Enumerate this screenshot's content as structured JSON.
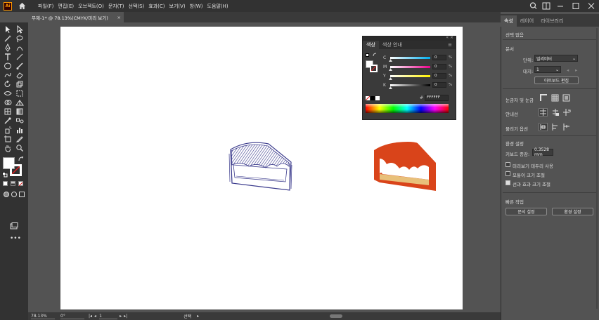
{
  "app": {
    "logo": "Ai",
    "menus": [
      "파일(F)",
      "편집(E)",
      "오브젝트(O)",
      "문자(T)",
      "선택(S)",
      "효과(C)",
      "보기(V)",
      "창(W)",
      "도움말(H)"
    ]
  },
  "document_tab": {
    "title": "무제-1* @ 78.13%(CMYK/미리 보기)",
    "close": "×"
  },
  "status_bar": {
    "zoom": "78.13%",
    "rotation": "0°",
    "artboard_number": "1",
    "selection_tool": "선택"
  },
  "right_panel": {
    "tabs": [
      "속성",
      "레이어",
      "라이브러리"
    ],
    "active_tab": "속성",
    "no_selection": "선택 없음",
    "document_section": "문서",
    "units_label": "단위:",
    "units_value": "밀리미터",
    "artboard_label": "대지:",
    "artboard_value": "1",
    "edit_artboard_button": "아트보드 편집",
    "rulers_grids_label": "눈금자 및 눈금",
    "guides_label": "안내선",
    "snap_options_label": "물리기 옵션",
    "preferences_section": "환경 설정",
    "keyboard_increment_label": "키보드 증감:",
    "keyboard_increment_value": "0.3528 mm",
    "checkbox_1": "미리보기 테두리 사용",
    "checkbox_2": "모퉁이 크기 조절",
    "checkbox_3": "선과 효과 크기 조절",
    "quick_actions_section": "빠른 작업",
    "document_setup_button": "문서 설정",
    "preferences_button": "환경 설정"
  },
  "color_panel": {
    "tabs": [
      "색상",
      "색상 안내"
    ],
    "active_tab": "색상",
    "sliders": [
      {
        "label": "C",
        "value": "0",
        "unit": "%"
      },
      {
        "label": "M",
        "value": "0",
        "unit": "%"
      },
      {
        "label": "Y",
        "value": "0",
        "unit": "%"
      },
      {
        "label": "K",
        "value": "0",
        "unit": "%"
      }
    ],
    "hex_prefix": "#",
    "hex_value": "FFFFFF"
  },
  "colors": {
    "accent_orange": "#d9441a",
    "cake_base": "#e8c07a",
    "sketch_ink": "#3a3a8c"
  },
  "toolbar_icons": [
    "selection-tool",
    "direct-selection-tool",
    "magic-wand-tool",
    "lasso-tool",
    "pen-tool",
    "curvature-tool",
    "type-tool",
    "line-tool",
    "rectangle-tool",
    "paintbrush-tool",
    "shaper-tool",
    "eraser-tool",
    "rotate-tool",
    "scale-tool",
    "width-tool",
    "free-transform-tool",
    "shape-builder-tool",
    "perspective-tool",
    "mesh-tool",
    "gradient-tool",
    "eyedropper-tool",
    "blend-tool",
    "symbol-sprayer-tool",
    "graph-tool",
    "artboard-tool",
    "slice-tool",
    "hand-tool",
    "zoom-tool"
  ]
}
